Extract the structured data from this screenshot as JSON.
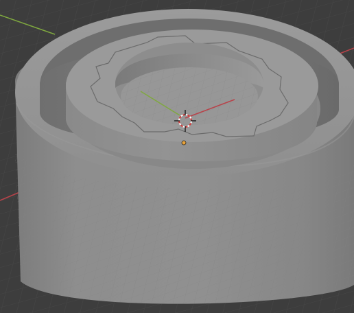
{
  "viewport": {
    "background_color": "#3d3d3d",
    "grid_color": "#4a4a4a",
    "axis_x_color": "#b8434a",
    "axis_y_color": "#7fa83f",
    "mesh_color": "#8c8c8c"
  },
  "scene": {
    "object_type": "bearing-housing-with-gear-cutout",
    "view": "perspective",
    "shading": "solid",
    "cursor_icon": "3d-cursor-icon",
    "origin_icon": "object-origin-icon",
    "origin_color": "#e8a33a"
  }
}
